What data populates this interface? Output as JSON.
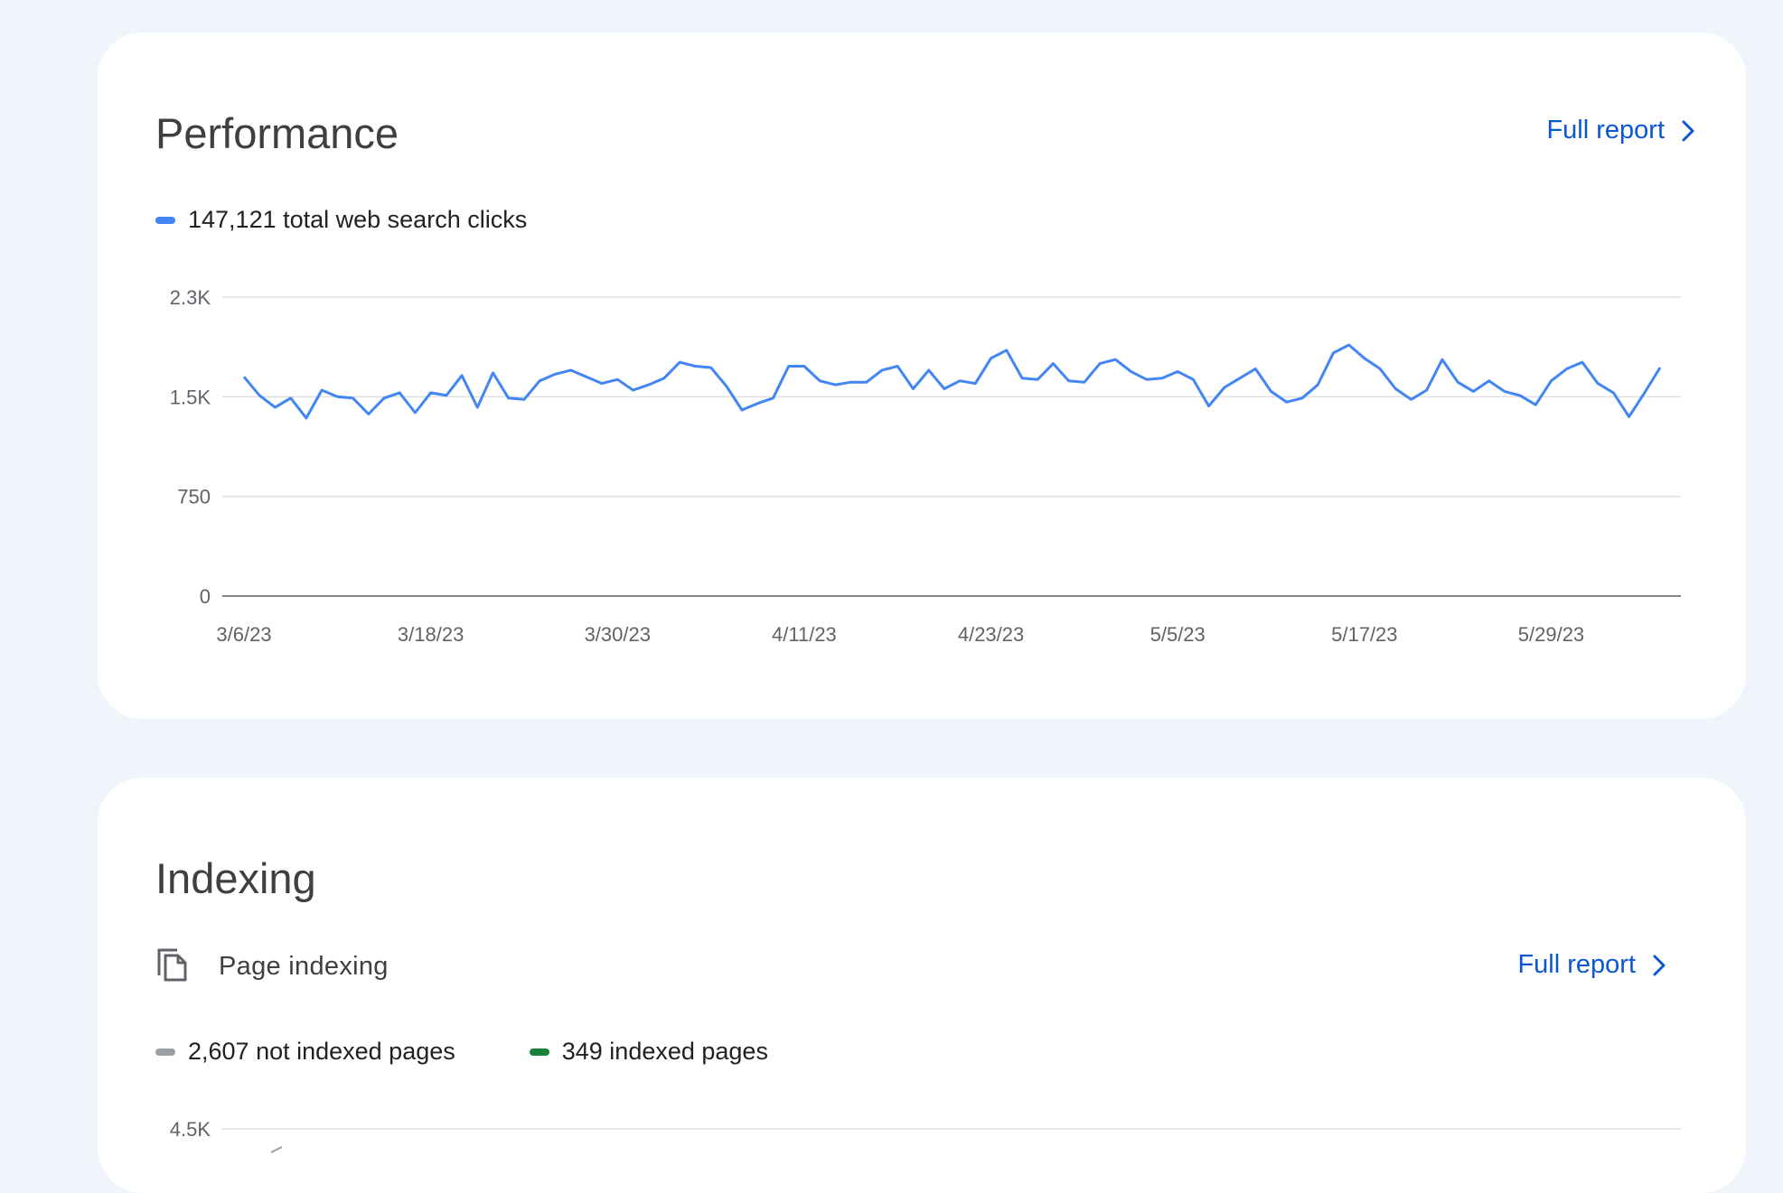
{
  "performance": {
    "title": "Performance",
    "full_report_label": "Full report",
    "full_report_icon": "chevron-right-icon",
    "legend": [
      {
        "label": "147,121 total web search clicks",
        "color": "#4285f4"
      }
    ]
  },
  "indexing": {
    "title": "Indexing",
    "section_icon": "copy-pages-icon",
    "section_label": "Page indexing",
    "full_report_label": "Full report",
    "full_report_icon": "chevron-right-icon",
    "legend": [
      {
        "label": "2,607 not indexed pages",
        "color": "#9aa0a6"
      },
      {
        "label": "349 indexed pages",
        "color": "#188038"
      }
    ],
    "y_tick_top": "4.5K"
  },
  "chart_data": [
    {
      "type": "line",
      "ylim": [
        0,
        2250
      ],
      "y_ticks": [
        {
          "value": 0,
          "label": "0"
        },
        {
          "value": 750,
          "label": "750"
        },
        {
          "value": 1500,
          "label": "1.5K"
        },
        {
          "value": 2250,
          "label": "2.3K"
        }
      ],
      "x_tick_labels": [
        "3/6/23",
        "3/18/23",
        "3/30/23",
        "4/11/23",
        "4/23/23",
        "5/5/23",
        "5/17/23",
        "5/29/23"
      ],
      "x_tick_index": [
        0,
        12,
        24,
        36,
        48,
        60,
        72,
        84
      ],
      "grid": true,
      "line_color": "#4285f4",
      "series": [
        {
          "name": "total web search clicks",
          "values": [
            1650,
            1510,
            1420,
            1490,
            1340,
            1550,
            1500,
            1490,
            1370,
            1490,
            1530,
            1380,
            1530,
            1510,
            1660,
            1420,
            1680,
            1490,
            1480,
            1620,
            1670,
            1700,
            1650,
            1600,
            1630,
            1550,
            1590,
            1640,
            1760,
            1730,
            1720,
            1580,
            1400,
            1450,
            1490,
            1730,
            1730,
            1620,
            1590,
            1610,
            1610,
            1700,
            1730,
            1560,
            1700,
            1560,
            1620,
            1600,
            1790,
            1850,
            1640,
            1630,
            1750,
            1620,
            1610,
            1750,
            1780,
            1690,
            1630,
            1640,
            1690,
            1630,
            1430,
            1570,
            1640,
            1710,
            1540,
            1460,
            1490,
            1590,
            1830,
            1890,
            1790,
            1710,
            1560,
            1480,
            1550,
            1780,
            1610,
            1540,
            1620,
            1540,
            1510,
            1440,
            1620,
            1710,
            1760,
            1600,
            1530,
            1350,
            1530,
            1720
          ]
        }
      ]
    }
  ]
}
